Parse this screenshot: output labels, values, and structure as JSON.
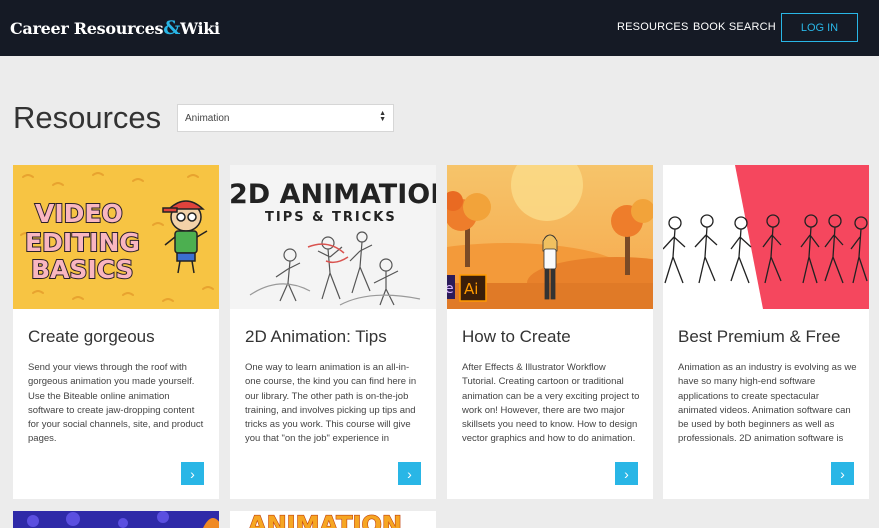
{
  "header": {
    "brand_part1": "Career Resources",
    "brand_amp": "&",
    "brand_part2": "Wiki",
    "nav": {
      "resources": "RESOURCES",
      "book_search": "BOOK SEARCH",
      "login": "LOG IN"
    },
    "background_color": "#151a25",
    "accent_color": "#29b6e6"
  },
  "main": {
    "title": "Resources",
    "filter": {
      "selected": "Animation"
    }
  },
  "cards": [
    {
      "title": "Create gorgeous",
      "description": "Send your views through the roof with gorgeous animation you made yourself. Use the Biteable online animation software to create jaw-dropping content for your social channels, site, and product pages.",
      "thumb_text": [
        "VIDEO",
        "EDITING",
        "BASICS"
      ]
    },
    {
      "title": "2D Animation: Tips",
      "description": "One way to learn animation is an all-in-one course, the kind you can find here in our library. The other path is on-the-job training, and involves picking up tips and tricks as you work. This course will give you that \"on the job\" experience in",
      "thumb_text": [
        "2D ANIMATION",
        "TIPS & TRICKS"
      ]
    },
    {
      "title": "How to Create",
      "description": "After Effects & Illustrator Workflow Tutorial. Creating cartoon or traditional animation can be a very exciting project to work on! However, there are two major skillsets you need to know. How to design vector graphics and how to do animation.",
      "thumb_text": [
        "Ai"
      ]
    },
    {
      "title": "Best Premium & Free",
      "description": "Animation as an industry is evolving as we have so many high-end software applications to create spectacular animated videos. Animation software can be used by both beginners as well as professionals. 2D animation software is",
      "thumb_text": []
    }
  ],
  "partial_cards": [
    "ANIMATION"
  ]
}
